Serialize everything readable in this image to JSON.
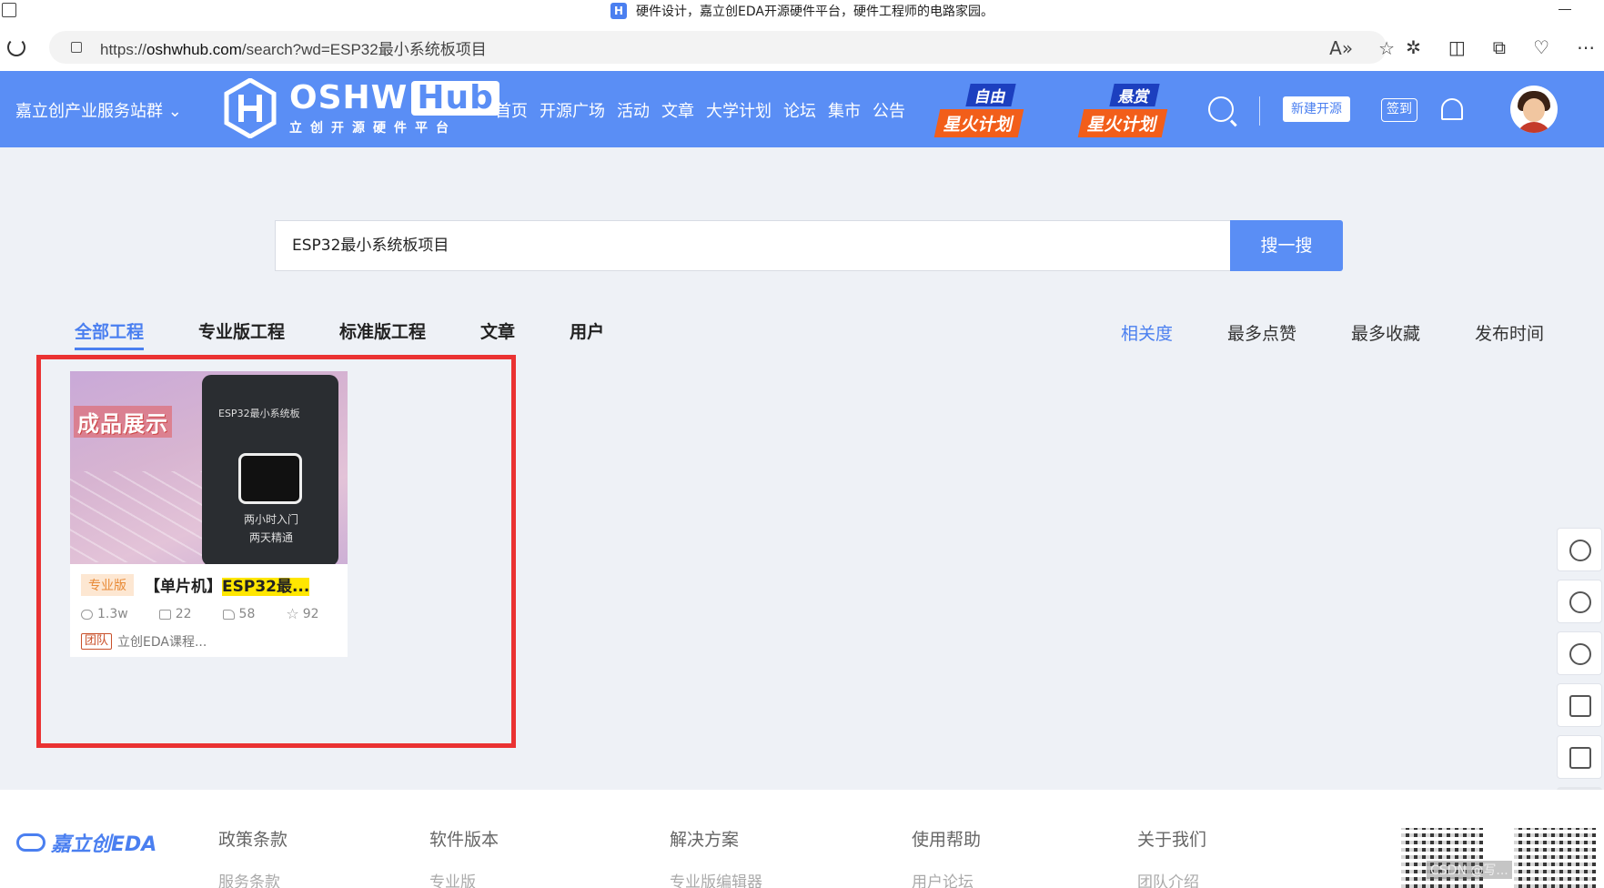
{
  "browser": {
    "window_title": "硬件设计，嘉立创EDA开源硬件平台，硬件工程师的电路家园。",
    "site_icon": "H",
    "url_prefix": "https://",
    "url_domain": "oshwhub.com",
    "url_path": "/search?wd=ESP32最小系统板项目"
  },
  "header": {
    "service_link": "嘉立创产业服务站群",
    "logo_main": "OSHW",
    "logo_hub": "Hub",
    "logo_sub": "立创开源硬件平台",
    "nav": [
      "首页",
      "开源广场",
      "活动",
      "文章",
      "大学计划",
      "论坛",
      "集市",
      "公告"
    ],
    "promo1_top": "自由",
    "promo1_bottom": "星火计划",
    "promo2_top": "悬赏",
    "promo2_bottom": "星火计划",
    "new_project": "新建开源",
    "sign_in": "签到",
    "colors": {
      "primary": "#5a8ef5",
      "promo_blue": "#1c3fbf",
      "promo_orange": "#f25e1a"
    }
  },
  "search": {
    "value": "ESP32最小系统板项目",
    "button": "搜一搜"
  },
  "tabs": [
    {
      "label": "全部工程",
      "active": true
    },
    {
      "label": "专业版工程",
      "active": false
    },
    {
      "label": "标准版工程",
      "active": false
    },
    {
      "label": "文章",
      "active": false
    },
    {
      "label": "用户",
      "active": false
    }
  ],
  "sorts": [
    {
      "label": "相关度",
      "active": true
    },
    {
      "label": "最多点赞",
      "active": false
    },
    {
      "label": "最多收藏",
      "active": false
    },
    {
      "label": "发布时间",
      "active": false
    }
  ],
  "results": [
    {
      "thumbnail": {
        "banner": "成品展示",
        "board_title": "ESP32最小系统板",
        "board_line1": "两小时入门",
        "board_line2": "两天精通"
      },
      "badge": "专业版",
      "title_prefix": "【单片机】",
      "title_highlight": "ESP32最...",
      "views": "1.3w",
      "comments": "22",
      "likes": "58",
      "favorites": "92",
      "owner_badge": "团队",
      "owner": "立创EDA课程..."
    }
  ],
  "footer": {
    "logo": "嘉立创EDA",
    "columns": [
      {
        "head": "政策条款",
        "sub": "服务条款"
      },
      {
        "head": "软件版本",
        "sub": "专业版"
      },
      {
        "head": "解决方案",
        "sub": "专业版编辑器"
      },
      {
        "head": "使用帮助",
        "sub": "用户论坛"
      },
      {
        "head": "关于我们",
        "sub": "团队介绍"
      }
    ],
    "watermark": "CSDN @写..."
  }
}
